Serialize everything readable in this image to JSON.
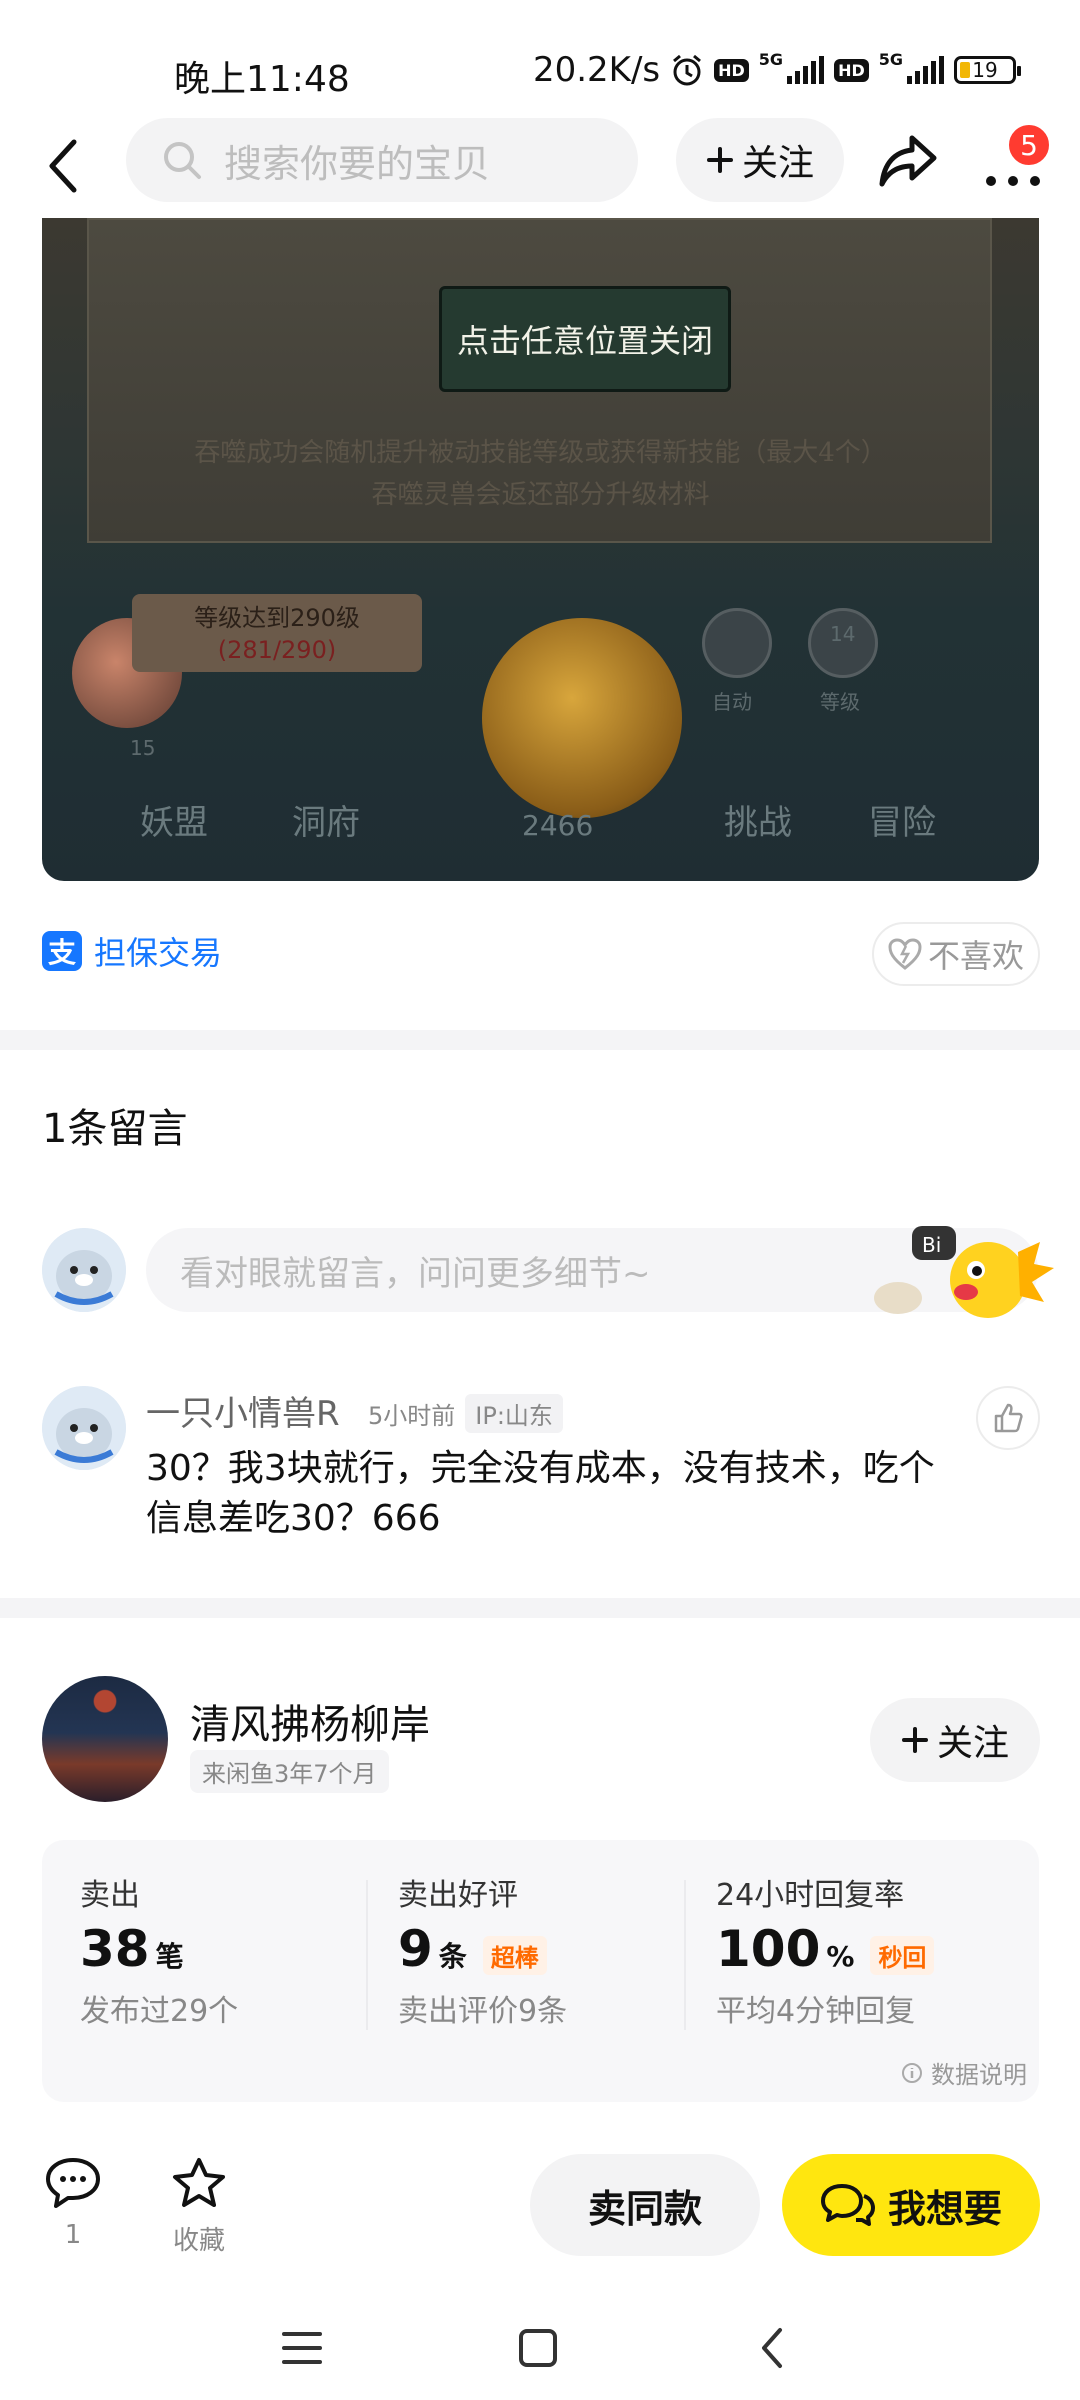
{
  "status_bar": {
    "time": "晚上11:48",
    "net_speed": "20.2K/s",
    "battery": "19",
    "hd": "HD",
    "net_type": "5G"
  },
  "nav": {
    "search_placeholder": "搜索你要的宝贝",
    "follow_label": "关注",
    "badge_count": "5"
  },
  "product_image": {
    "close_hint": "点击任意位置关闭",
    "dialog_line1": "吞噬成功会随机提升被动技能等级或获得新技能（最大4个）",
    "dialog_line2": "吞噬灵兽会返还部分升级材料",
    "level_text": "等级达到290级",
    "level_progress": "(281/290)",
    "coin_count": "2466",
    "level_badge": "14",
    "level_badge_label": "等级",
    "auto_label": "自动",
    "peach_count": "15",
    "tabs": [
      "妖盟",
      "洞府",
      "挑战",
      "冒险"
    ]
  },
  "trade": {
    "alipay_glyph": "支",
    "label": "担保交易",
    "dislike_label": "不喜欢"
  },
  "comments": {
    "title": "1条留言",
    "input_placeholder": "看对眼就留言，问问更多细节~",
    "mascot_bubble": "Bi",
    "items": [
      {
        "name": "一只小情兽R",
        "time": "5小时前",
        "ip": "IP:山东",
        "text": "30？我3块就行，完全没有成本，没有技术，吃个信息差吃30？666"
      }
    ]
  },
  "seller": {
    "name": "清风拂杨柳岸",
    "since": "来闲鱼3年7个月",
    "follow_label": "关注",
    "stats": [
      {
        "label": "卖出",
        "value": "38",
        "unit": "笔",
        "flag": "",
        "foot": "发布过29个"
      },
      {
        "label": "卖出好评",
        "value": "9",
        "unit": "条",
        "flag": "超棒",
        "foot": "卖出评价9条"
      },
      {
        "label": "24小时回复率",
        "value": "100",
        "unit": "%",
        "flag": "秒回",
        "foot": "平均4分钟回复"
      }
    ],
    "data_note": "数据说明"
  },
  "bottom_bar": {
    "comment_count": "1",
    "favorite_label": "收藏",
    "sell_same_label": "卖同款",
    "want_label": "我想要"
  },
  "colors": {
    "accent_yellow": "#ffe60f",
    "link_blue": "#1677ff",
    "badge_red": "#ff3b30",
    "flag_orange": "#ff6a00"
  }
}
